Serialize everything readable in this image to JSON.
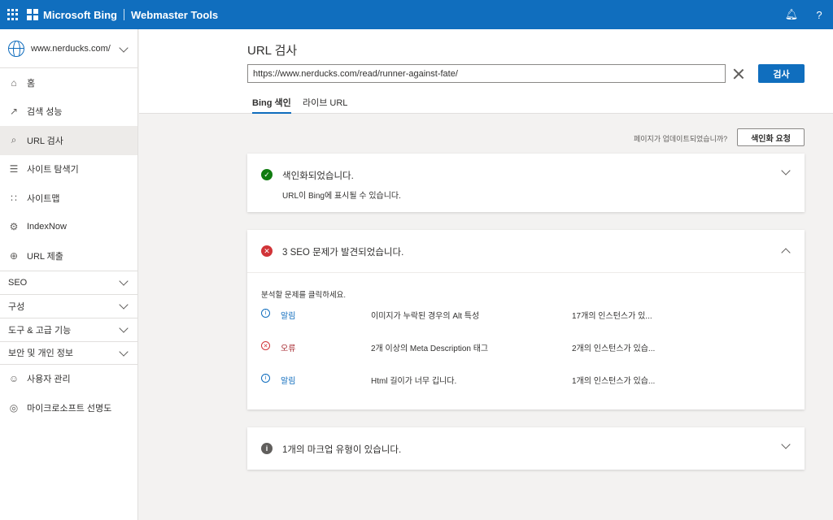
{
  "app": {
    "brand": "Microsoft Bing",
    "product": "Webmaster Tools"
  },
  "sidebar": {
    "site": "www.nerducks.com/",
    "items": [
      {
        "label": "홈",
        "icon": "home-icon"
      },
      {
        "label": "검색 성능",
        "icon": "trend-icon"
      },
      {
        "label": "URL 검사",
        "icon": "search-icon",
        "active": true
      },
      {
        "label": "사이트 탐색기",
        "icon": "document-icon"
      },
      {
        "label": "사이트맵",
        "icon": "sitemap-icon"
      },
      {
        "label": "IndexNow",
        "icon": "gear-icon"
      },
      {
        "label": "URL 제출",
        "icon": "globe-icon"
      }
    ],
    "groups": [
      "SEO",
      "구성",
      "도구 & 고급 기능",
      "보안 및 개인 정보"
    ],
    "bottom": [
      {
        "label": "사용자 관리",
        "icon": "user-icon"
      },
      {
        "label": "마이크로소프트 선명도",
        "icon": "clarity-icon"
      }
    ]
  },
  "header": {
    "title": "URL 검사",
    "url_value": "https://www.nerducks.com/read/runner-against-fate/",
    "search_label": "검사",
    "tabs": [
      "Bing 색인",
      "라이브 URL"
    ]
  },
  "request": {
    "question": "페이지가 업데이트되었습니까?",
    "button": "색인화 요청"
  },
  "cards": {
    "indexed": {
      "title": "색인화되었습니다.",
      "sub": "URL이 Bing에 표시될 수 있습니다."
    },
    "seo": {
      "title": "3 SEO 문제가 발견되었습니다.",
      "hint": "분석할 문제를 클릭하세요.",
      "issues": [
        {
          "type": "알림",
          "desc": "이미지가 누락된 경우의 Alt 특성",
          "count": "17개의 인스턴스가 있..."
        },
        {
          "type": "오류",
          "desc": "2개 이상의 Meta Description 태그",
          "count": "2개의 인스턴스가 있습..."
        },
        {
          "type": "알림",
          "desc": "Html 길이가 너무 깁니다.",
          "count": "1개의 인스턴스가 있습..."
        }
      ]
    },
    "markup": {
      "title": "1개의 마크업 유형이 있습니다."
    }
  },
  "colors": {
    "accent": "#106ebe",
    "ok": "#107c10",
    "error": "#d13438"
  }
}
